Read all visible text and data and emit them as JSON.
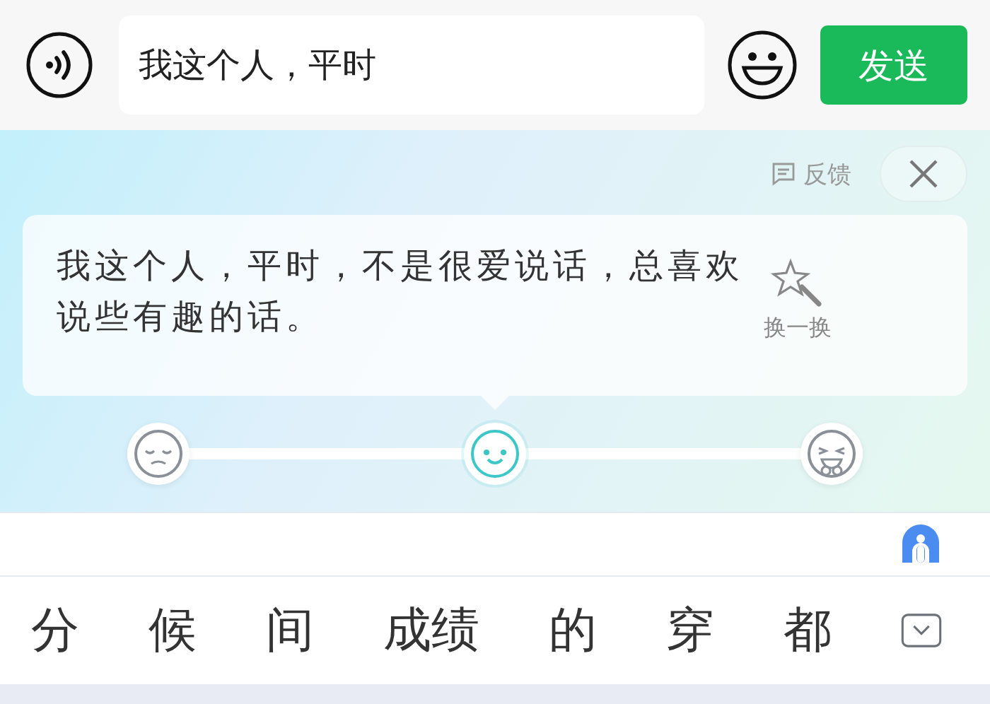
{
  "input_bar": {
    "text": "我这个人，平时",
    "send_button": "发送"
  },
  "suggestion_panel": {
    "feedback": "反馈",
    "suggestion": "我这个人，平时，不是很爱说话，总喜欢说些有趣的话。",
    "refresh": "换一换",
    "moods": [
      {
        "kind": "sad",
        "selected": false
      },
      {
        "kind": "smile",
        "selected": true
      },
      {
        "kind": "laugh",
        "selected": false
      }
    ]
  },
  "candidates": [
    {
      "label": "分"
    },
    {
      "label": "候"
    },
    {
      "label": "间"
    },
    {
      "label": "成绩"
    },
    {
      "label": "的"
    },
    {
      "label": "穿"
    },
    {
      "label": "都"
    }
  ]
}
